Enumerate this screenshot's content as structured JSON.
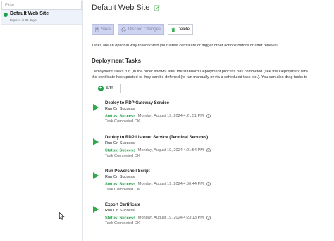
{
  "sidebar": {
    "filter_placeholder": "Filter...",
    "site": {
      "title": "Default Web Site",
      "subtitle": "Expires in 89 days",
      "status_color": "#1aa24a"
    }
  },
  "header": {
    "title": "Default Web Site",
    "edit_icon": "edit-icon"
  },
  "toolbar": {
    "save_label": "Save",
    "discard_label": "Discard Changes",
    "delete_label": "Delete"
  },
  "description": "Tasks are an optional way to work with your latest certificate or trigger other actions before or after renewal.",
  "deployment": {
    "heading": "Deployment Tasks",
    "intro_line1": "Deployment Tasks run (in the order shown) after the standard Deployment process has completed (see the Deployment tab)",
    "intro_line2": "the certificate has updated or they can be deferred (to run manually or via a scheduled task etc.). You can also drag tasks to",
    "add_label": "Add",
    "tasks": [
      {
        "name": "Deploy to RDP Gateway Service",
        "run": "Run On Success",
        "status": "Status: Success",
        "time": "Monday, August 19, 2024 4:21:51 PM",
        "completed": "Task Completed OK"
      },
      {
        "name": "Deploy to RDP Listener Service (Terminal Services)",
        "run": "Run On Success",
        "status": "Status: Success",
        "time": "Monday, August 19, 2024 4:21:54 PM",
        "completed": "Task Completed OK"
      },
      {
        "name": "Run Powershell Script",
        "run": "Run On Success",
        "status": "Status: Success",
        "time": "Monday, August 19, 2024 4:50:44 PM",
        "completed": "Task Completed OK"
      },
      {
        "name": "Export Certificate",
        "run": "Run On Success",
        "status": "Status: Success",
        "time": "Monday, August 19, 2024 4:23:13 PM",
        "completed": "Task Completed OK"
      }
    ]
  },
  "colors": {
    "success": "#24a04a",
    "accent_disabled": "#cfd4f0",
    "selection": "#eef3fb"
  }
}
